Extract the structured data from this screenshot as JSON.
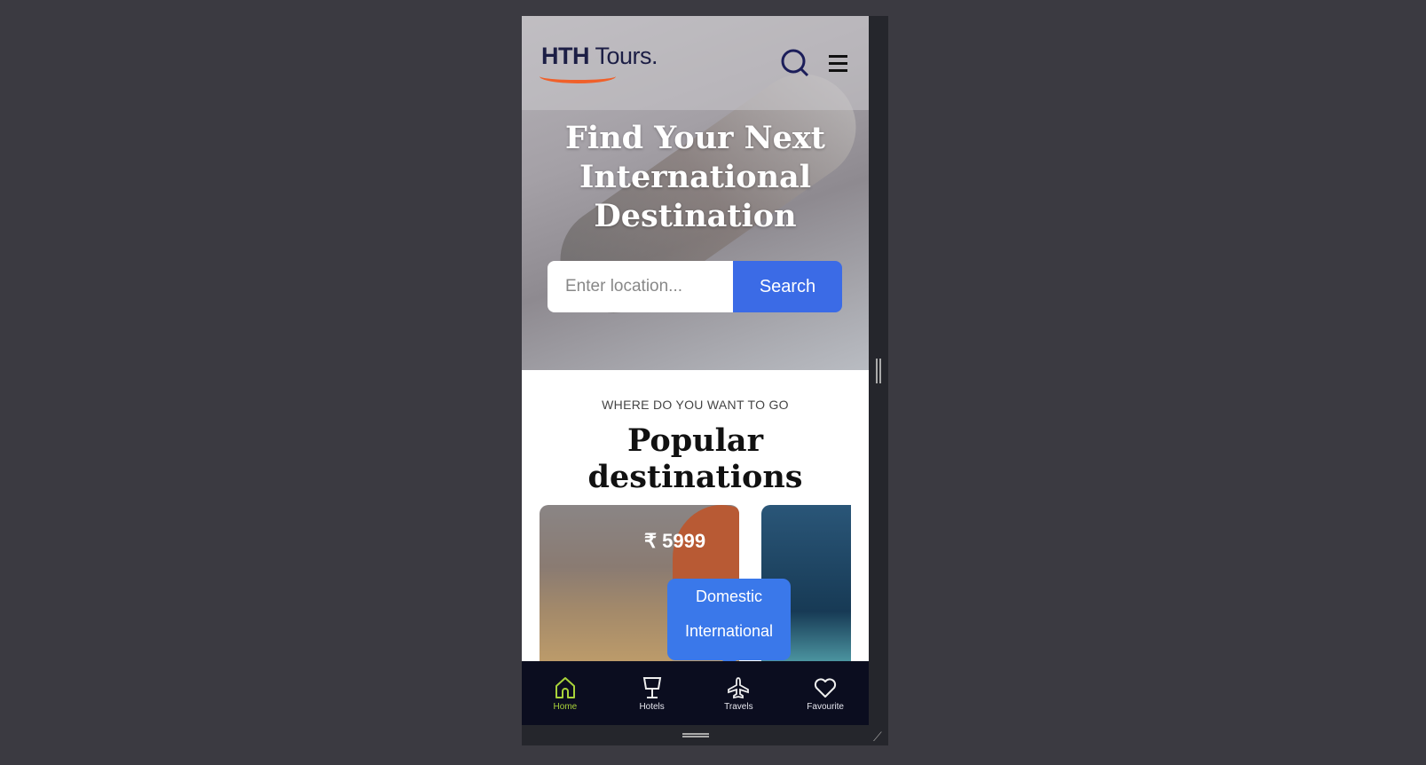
{
  "header": {
    "logo_bold": "HTH",
    "logo_rest": " Tours."
  },
  "hero": {
    "title": "Find Your Next International Destination",
    "search_placeholder": "Enter location...",
    "search_button": "Search"
  },
  "section": {
    "subtitle": "WHERE DO YOU WANT TO GO",
    "title": "Popular destinations"
  },
  "cards": [
    {
      "price": "₹ 5999"
    }
  ],
  "travel_menu": [
    "Domestic",
    "International"
  ],
  "nav": [
    {
      "label": "Home",
      "icon": "home-icon",
      "active": true
    },
    {
      "label": "Hotels",
      "icon": "lamp-icon"
    },
    {
      "label": "Travels",
      "icon": "plane-icon"
    },
    {
      "label": "Favourite",
      "icon": "heart-icon"
    }
  ],
  "colors": {
    "accent": "#3b6be6",
    "nav_bg": "#0b0d1f",
    "active": "#a8d23a",
    "logo_swoosh": "#f0602a"
  }
}
